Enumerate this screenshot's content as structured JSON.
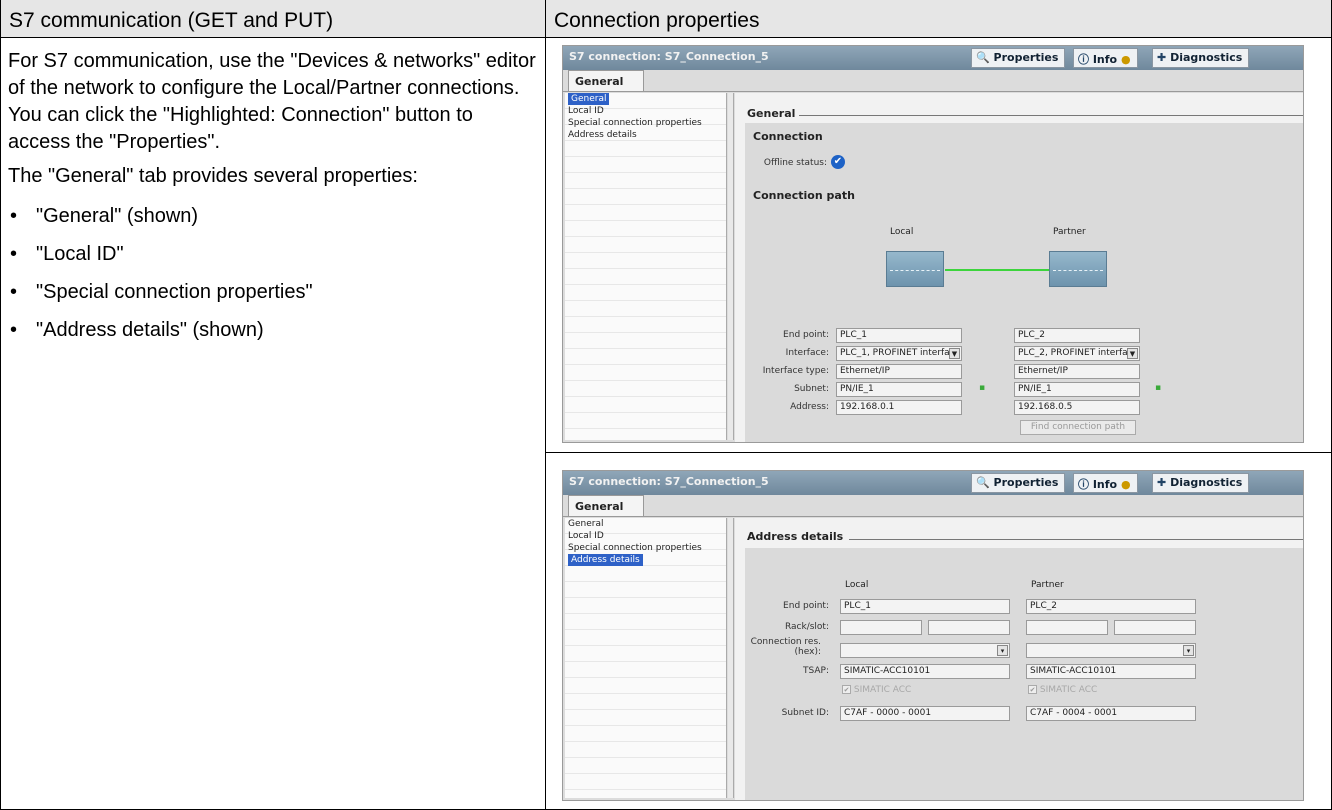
{
  "header": {
    "left": "S7 communication (GET and PUT)",
    "right": "Connection properties"
  },
  "description": {
    "para1": "For S7 communication, use the \"Devices & networks\" editor of the network to configure the Local/Partner connections. You can click the \"Highlighted: Connection\" button to access the \"Properties\".",
    "para2": "The \"General\" tab provides several properties:",
    "bullets": [
      "\"General\" (shown)",
      "\"Local ID\"",
      "\"Special connection properties\"",
      "\"Address details\" (shown)"
    ]
  },
  "panel": {
    "title": "S7 connection: S7_Connection_5",
    "tabs": {
      "properties": "Properties",
      "info": "Info",
      "diagnostics": "Diagnostics"
    },
    "general_tab": "General",
    "nav": [
      "General",
      "Local ID",
      "Special connection properties",
      "Address details"
    ]
  },
  "general_view": {
    "section": "General",
    "connection": "Connection",
    "offline_status_label": "Offline status:",
    "connection_path": "Connection path",
    "local": "Local",
    "partner": "Partner",
    "labels": {
      "end_point": "End point:",
      "interface": "Interface:",
      "interface_type": "Interface type:",
      "subnet": "Subnet:",
      "address": "Address:"
    },
    "local_values": {
      "end_point": "PLC_1",
      "interface": "PLC_1, PROFINET interfa",
      "interface_type": "Ethernet/IP",
      "subnet": "PN/IE_1",
      "address": "192.168.0.1"
    },
    "partner_values": {
      "end_point": "PLC_2",
      "interface": "PLC_2, PROFINET interfa",
      "interface_type": "Ethernet/IP",
      "subnet": "PN/IE_1",
      "address": "192.168.0.5"
    },
    "find_button": "Find connection path"
  },
  "address_view": {
    "section": "Address details",
    "local": "Local",
    "partner": "Partner",
    "labels": {
      "end_point": "End point:",
      "rack_slot": "Rack/slot:",
      "conn_res": "Connection res. (hex):",
      "tsap": "TSAP:",
      "subnet_id": "Subnet ID:"
    },
    "local_values": {
      "end_point": "PLC_1",
      "tsap": "SIMATIC-ACC10101",
      "checkbox": "SIMATIC ACC",
      "subnet_id": "C7AF - 0000 - 0001"
    },
    "partner_values": {
      "end_point": "PLC_2",
      "tsap": "SIMATIC-ACC10101",
      "checkbox": "SIMATIC ACC",
      "subnet_id": "C7AF - 0004 - 0001"
    }
  },
  "colors": {
    "header_bg": "#e6e6e6",
    "selection": "#2e61c7",
    "title_bar": "#7a92a6"
  }
}
